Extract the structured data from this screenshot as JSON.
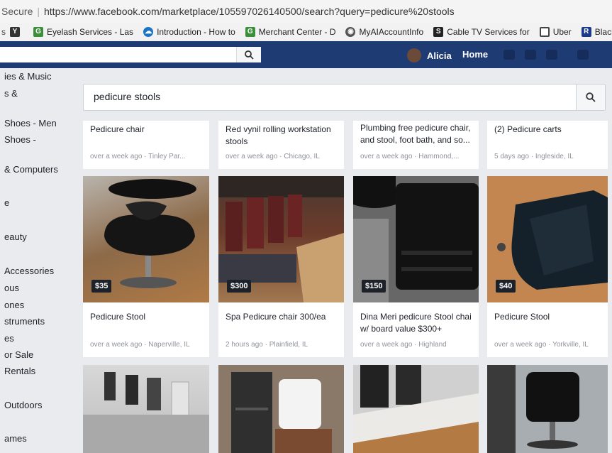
{
  "browser": {
    "security": "Secure",
    "url": "https://www.facebook.com/marketplace/105597026140500/search?query=pedicure%20stools"
  },
  "bookmarks": [
    {
      "label": "",
      "icon": "y-icon",
      "color": "#333333"
    },
    {
      "label": "Eyelash Services - Las",
      "icon": "google-icon",
      "color": "#3b8f3b"
    },
    {
      "label": "Introduction - How to",
      "icon": "cloud-icon",
      "color": "#1b74c4"
    },
    {
      "label": "Merchant Center - D",
      "icon": "google-icon",
      "color": "#3b8f3b"
    },
    {
      "label": "MyAIAccountInfo",
      "icon": "globe-icon",
      "color": "#555555"
    },
    {
      "label": "Cable TV Services for",
      "icon": "s-icon",
      "color": "#222222"
    },
    {
      "label": "Uber",
      "icon": "square-icon",
      "color": "#444444"
    },
    {
      "label": "Black Tulip S",
      "icon": "r-icon",
      "color": "#1b3a8c"
    }
  ],
  "fb": {
    "user": "Alicia",
    "home": "Home"
  },
  "sidebar": [
    "ies & Music",
    "s &",
    "",
    "Shoes - Men",
    "Shoes -",
    "& Computers",
    "e",
    "eauty",
    "Accessories",
    "ous",
    "ones",
    "struments",
    "es",
    "or Sale",
    "Rentals",
    "Outdoors",
    "ames"
  ],
  "search": {
    "value": "pedicure stools"
  },
  "top_listings": [
    {
      "title": "Pedicure chair",
      "meta": "over a week ago · Tinley Par..."
    },
    {
      "title": "Red vynil rolling workstation stools",
      "meta": "over a week ago · Chicago, IL"
    },
    {
      "title": "Plumbing free pedicure chair, and stool, foot bath, and so...",
      "meta": "over a week ago · Hammond,..."
    },
    {
      "title": "(2) Pedicure carts",
      "meta": "5 days ago · Ingleside, IL"
    }
  ],
  "listings": [
    {
      "price": "$35",
      "title": "Pedicure Stool",
      "meta": "over a week ago · Naperville, IL"
    },
    {
      "price": "$300",
      "title": "Spa Pedicure chair 300/ea",
      "meta": "2 hours ago · Plainfield, IL"
    },
    {
      "price": "$150",
      "title": "Dina Meri pedicure Stool chai w/ board value $300+",
      "meta": "over a week ago · Highland"
    },
    {
      "price": "$40",
      "title": "Pedicure Stool",
      "meta": "over a week ago · Yorkville, IL"
    }
  ]
}
